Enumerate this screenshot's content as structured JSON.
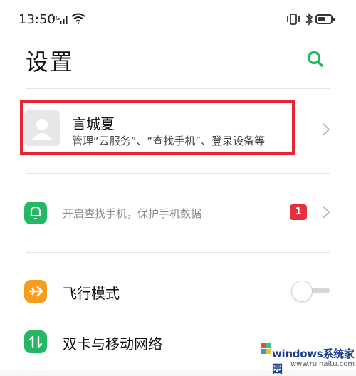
{
  "status_bar": {
    "time": "13:50",
    "icons": [
      "signal-icon",
      "wifi-icon",
      "vibrate-icon",
      "bluetooth-icon",
      "battery-icon"
    ],
    "battery_level": 0.55
  },
  "header": {
    "title": "设置",
    "search_icon": "search-icon",
    "accent": "#1db954"
  },
  "account": {
    "name": "言城夏",
    "description": "管理“云服务”、“查找手机”、登录设备等",
    "highlight_color": "#e4252f"
  },
  "find_phone": {
    "text": "开启查找手机，保护手机数据",
    "badge": "1",
    "icon_color": "#25b864",
    "badge_color": "#e4303f"
  },
  "airplane": {
    "label": "飞行模式",
    "icon_color": "#f59d1c",
    "enabled": false
  },
  "dual_sim": {
    "label": "双卡与移动网络",
    "icon_color": "#25b864"
  },
  "watermark": {
    "title": "windows系统家园",
    "url": "www.ruihaitu.com"
  }
}
